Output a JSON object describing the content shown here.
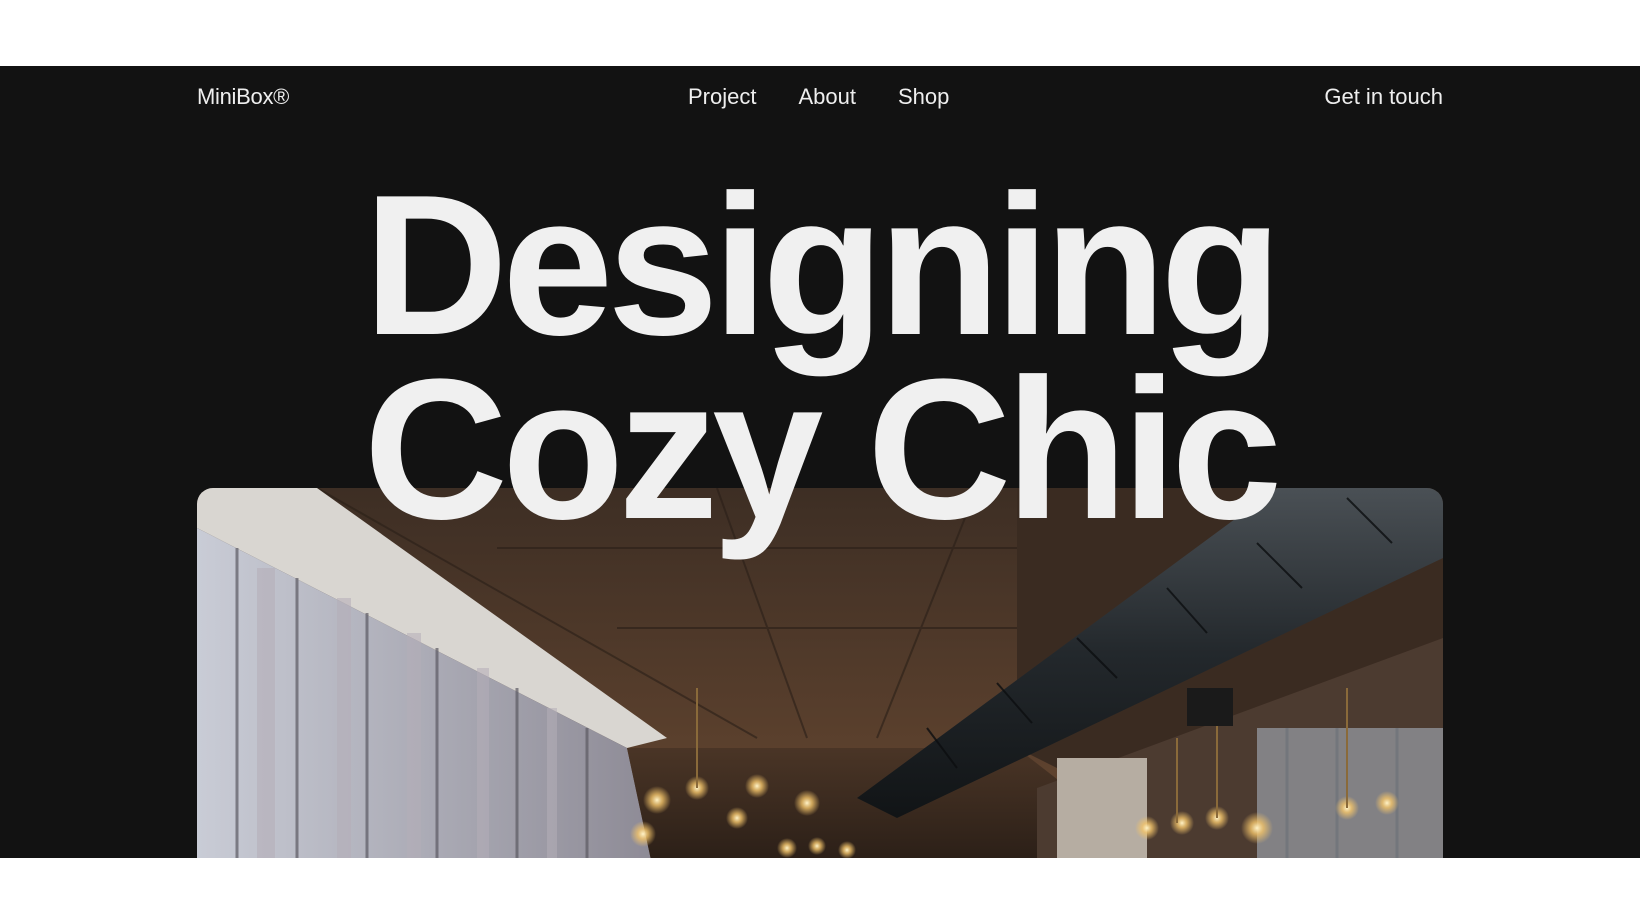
{
  "brand": {
    "logo": "MiniBox®"
  },
  "nav": {
    "items": [
      {
        "label": "Project"
      },
      {
        "label": "About"
      },
      {
        "label": "Shop"
      }
    ],
    "cta": "Get in touch"
  },
  "hero": {
    "title_line1": "Designing",
    "title_line2": "Cozy Chic",
    "image": "interior-photo"
  },
  "colors": {
    "background": "#121212",
    "text": "#f0f0f0",
    "page": "#ffffff"
  }
}
